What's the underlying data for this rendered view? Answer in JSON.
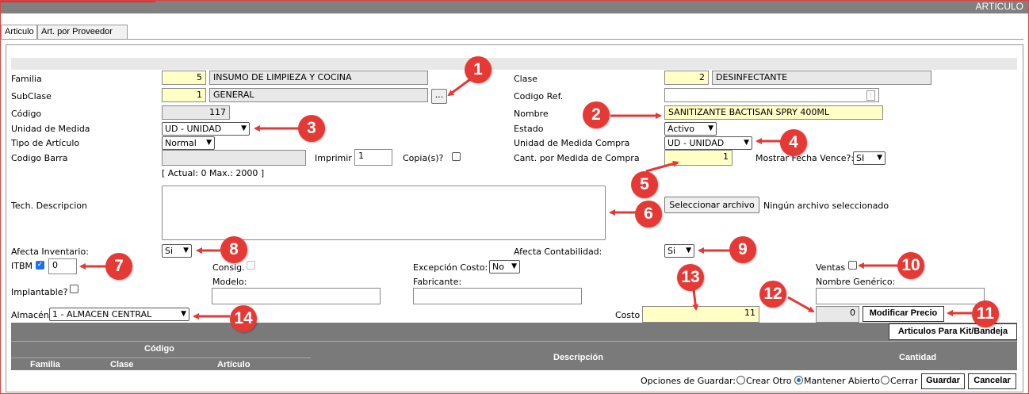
{
  "window": {
    "title": "ARTICULO"
  },
  "tabs": [
    {
      "label": "Articulo"
    },
    {
      "label": "Art. por Proveedor"
    }
  ],
  "form": {
    "familia": {
      "label": "Familia",
      "code": "5",
      "desc": "INSUMO DE LIMPIEZA Y COCINA"
    },
    "subclase": {
      "label": "SubClase",
      "code": "1",
      "desc": "GENERAL",
      "lookup_label": "..."
    },
    "codigo": {
      "label": "Código",
      "value": "117"
    },
    "unidad_medida": {
      "label": "Unidad de Medida",
      "value": "UD - UNIDAD"
    },
    "tipo_articulo": {
      "label": "Tipo de Artículo",
      "value": "Normal"
    },
    "codigo_barra": {
      "label": "Codigo Barra",
      "value": ""
    },
    "imprimir": {
      "label": "Imprimir",
      "value": "1",
      "copias_label": "Copia(s)?"
    },
    "barcode_hint": "[ Actual: 0   Max.: 2000 ]",
    "clase": {
      "label": "Clase",
      "code": "2",
      "desc": "DESINFECTANTE"
    },
    "codigo_ref": {
      "label": "Codigo Ref.",
      "value": ""
    },
    "nombre": {
      "label": "Nombre",
      "value": "SANITIZANTE BACTISAN SPRY 400ML"
    },
    "estado": {
      "label": "Estado",
      "value": "Activo"
    },
    "unidad_compra": {
      "label": "Unidad de Medida Compra",
      "value": "UD - UNIDAD"
    },
    "cant_medida_compra": {
      "label": "Cant. por Medida de Compra",
      "value": "1"
    },
    "mostrar_fecha_vence": {
      "label": "Mostrar Fecha Vence?:",
      "value": "SI"
    },
    "tech_descripcion": {
      "label": "Tech. Descripcion",
      "value": ""
    },
    "file": {
      "button_label": "Seleccionar archivo",
      "status": "Ningún archivo seleccionado"
    },
    "afecta_inventario": {
      "label": "Afecta Inventario:",
      "value": "Si"
    },
    "afecta_contabilidad": {
      "label": "Afecta Contabilidad:",
      "value": "Si"
    },
    "itbm": {
      "label": "ITBM",
      "checked": true,
      "value": "0"
    },
    "consig": {
      "label": "Consig."
    },
    "excepcion_costo": {
      "label": "Excepción Costo:",
      "value": "No"
    },
    "ventas": {
      "label": "Ventas"
    },
    "implantable": {
      "label": "Implantable?"
    },
    "modelo": {
      "label": "Modelo:",
      "value": ""
    },
    "fabricante": {
      "label": "Fabricante:",
      "value": ""
    },
    "nombre_generico": {
      "label": "Nombre Genérico:",
      "value": ""
    },
    "almacen": {
      "label": "Almacén",
      "value": "1 - ALMACEN CENTRAL"
    },
    "costo": {
      "label": "Costo",
      "value": "11"
    },
    "precio": {
      "value": "0"
    },
    "modificar_precio_label": "Modificar Precio",
    "kit_label": "Articulos Para Kit/Bandeja"
  },
  "table": {
    "group_header": "Código",
    "columns": [
      "Familia",
      "Clase",
      "Artículo",
      "Descripción",
      "Cantidad"
    ]
  },
  "save_options": {
    "label": "Opciones de Guardar:",
    "options": [
      "Crear Otro",
      "Mantener Abierto",
      "Cerrar"
    ],
    "selected": "Mantener Abierto",
    "save_label": "Guardar",
    "cancel_label": "Cancelar"
  },
  "markers": [
    "1",
    "2",
    "3",
    "4",
    "5",
    "6",
    "7",
    "8",
    "9",
    "10",
    "11",
    "12",
    "13",
    "14"
  ],
  "colors": {
    "marker": "#e53935",
    "highlight": "#ffffc6",
    "header": "#7a7a7a"
  }
}
